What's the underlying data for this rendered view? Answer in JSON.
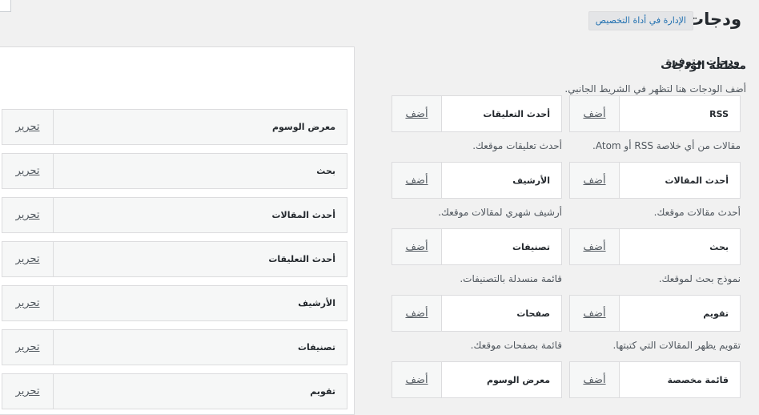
{
  "header": {
    "title": "ودجات",
    "customizer_link": "الإدارة في أداة التخصيص"
  },
  "available": {
    "title": "ودجات متوفرة",
    "add_label": "أضف",
    "widgets": [
      {
        "name": "RSS",
        "desc": "مقالات من أي خلاصة RSS أو Atom."
      },
      {
        "name": "أحدث التعليقات",
        "desc": "أحدث تعليقات موقعك."
      },
      {
        "name": "أحدث المقالات",
        "desc": "أحدث مقالات موقعك."
      },
      {
        "name": "الأرشيف",
        "desc": "أرشيف شهري لمقالات موقعك."
      },
      {
        "name": "بحث",
        "desc": "نموذج بحث لموقعك."
      },
      {
        "name": "تصنيفات",
        "desc": "قائمة منسدلة بالتصنيفات."
      },
      {
        "name": "تقويم",
        "desc": "تقويم يظهر المقالات التي كتبتها."
      },
      {
        "name": "صفحات",
        "desc": "قائمة بصفحات موقعك."
      },
      {
        "name": "قائمة مخصصة",
        "desc": ""
      },
      {
        "name": "معرض الوسوم",
        "desc": ""
      }
    ]
  },
  "sidebar": {
    "title": "منطقة الودجات",
    "description": "أضف الودجات هنا لتظهر في الشريط الجانبي.",
    "edit_label": "تحرير",
    "widgets": [
      "معرض الوسوم",
      "بحث",
      "أحدث المقالات",
      "أحدث التعليقات",
      "الأرشيف",
      "تصنيفات",
      "تقويم"
    ]
  }
}
